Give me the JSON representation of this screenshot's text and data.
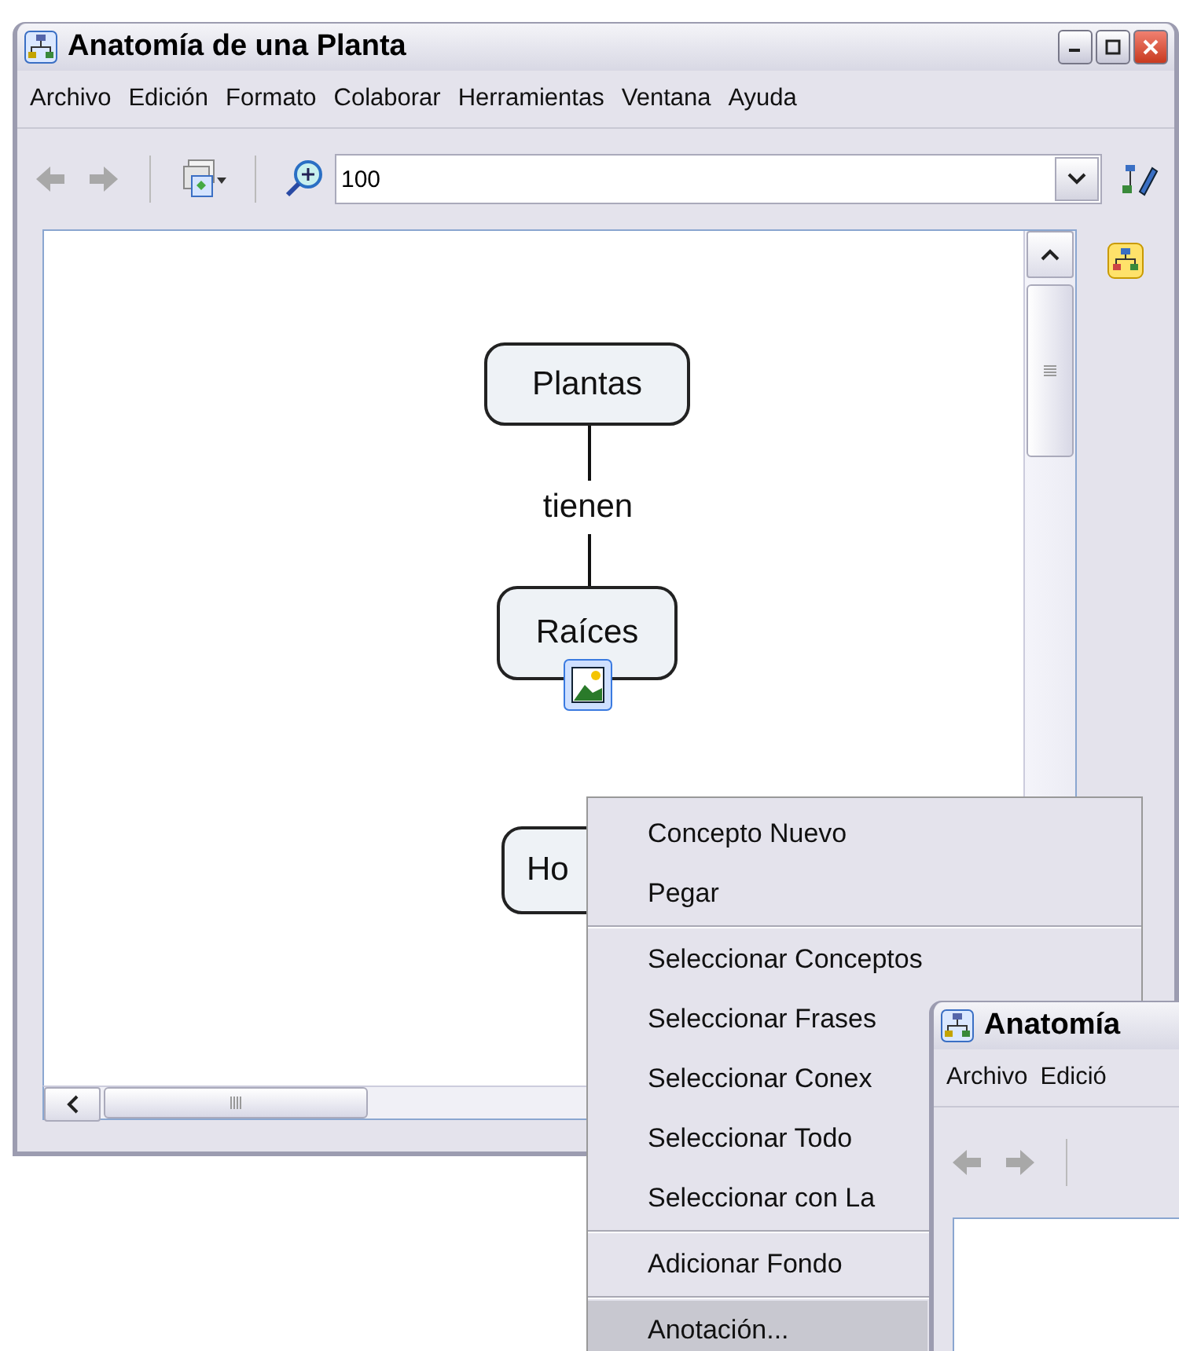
{
  "window": {
    "title": "Anatomía de una Planta"
  },
  "menu_bar": [
    "Archivo",
    "Edición",
    "Formato",
    "Colaborar",
    "Herramientas",
    "Ventana",
    "Ayuda"
  ],
  "toolbar": {
    "zoom_field": {
      "value": "100"
    }
  },
  "canvas": {
    "nodes": [
      {
        "kind": "concept",
        "label": "Plantas",
        "has_image": false
      },
      {
        "kind": "link",
        "label": "tienen"
      },
      {
        "kind": "concept",
        "label": "Raíces",
        "has_image": true
      },
      {
        "kind": "concept",
        "label": "Ho",
        "has_image": false
      }
    ]
  },
  "context_menu": {
    "groups": [
      [
        {
          "label": "Concepto Nuevo",
          "selected": false
        },
        {
          "label": "Pegar",
          "selected": false
        }
      ],
      [
        {
          "label": "Seleccionar Conceptos",
          "selected": false
        },
        {
          "label": "Seleccionar Frases",
          "selected": false
        },
        {
          "label": "Seleccionar Conex",
          "selected": false
        },
        {
          "label": "Seleccionar Todo",
          "selected": false
        },
        {
          "label": "Seleccionar con La",
          "selected": false
        }
      ],
      [
        {
          "label": "Adicionar Fondo",
          "selected": false
        }
      ],
      [
        {
          "label": "Anotación...",
          "selected": true
        }
      ]
    ]
  },
  "second_window": {
    "title": "Anatomía",
    "menu_bar": [
      "Archivo",
      "Edició"
    ]
  }
}
